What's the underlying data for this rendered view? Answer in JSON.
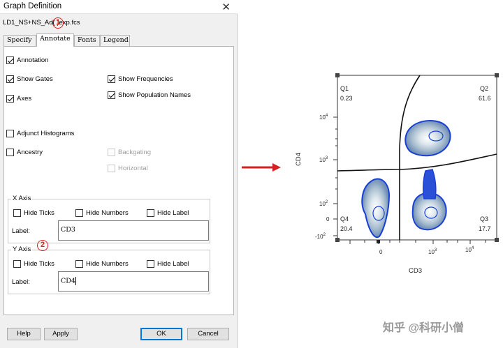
{
  "dialog": {
    "title": "Graph Definition",
    "close_glyph": "✕",
    "filename": "LD1_NS+NS_Ad(  )exp.fcs",
    "callout1": "1",
    "callout2": "2",
    "tabs": [
      {
        "label": "Specify",
        "active": false
      },
      {
        "label": "Annotate",
        "active": true
      },
      {
        "label": "Fonts",
        "active": false
      },
      {
        "label": "Legend",
        "active": false
      }
    ],
    "options": {
      "annotation": {
        "label": "Annotation",
        "checked": true
      },
      "show_gates": {
        "label": "Show Gates",
        "checked": true
      },
      "show_frequencies": {
        "label": "Show Frequencies",
        "checked": true
      },
      "axes": {
        "label": "Axes",
        "checked": true
      },
      "show_population_names": {
        "label": "Show Population Names",
        "checked": true
      },
      "adjunct_histograms": {
        "label": "Adjunct Histograms",
        "checked": false
      },
      "ancestry": {
        "label": "Ancestry",
        "checked": false
      },
      "backgating": {
        "label": "Backgating",
        "checked": false,
        "disabled": true
      },
      "horizontal": {
        "label": "Horizontal",
        "checked": false,
        "disabled": true
      }
    },
    "x_axis": {
      "title": "X Axis",
      "hide_ticks": "Hide Ticks",
      "hide_numbers": "Hide Numbers",
      "hide_label": "Hide Label",
      "label_caption": "Label:",
      "label_value": "CD3"
    },
    "y_axis": {
      "title": "Y Axis",
      "hide_ticks": "Hide Ticks",
      "hide_numbers": "Hide Numbers",
      "hide_label": "Hide Label",
      "label_caption": "Label:",
      "label_value": "CD4"
    },
    "buttons": {
      "help": "Help",
      "apply": "Apply",
      "ok": "OK",
      "cancel": "Cancel"
    }
  },
  "arrow_color": "#d42020",
  "plot": {
    "xlabel": "CD3",
    "ylabel": "CD4",
    "x_ticks": [
      "0",
      "10",
      "10"
    ],
    "x_tick_exps": [
      "",
      "3",
      "4"
    ],
    "y_ticks": [
      "10",
      "10",
      "10",
      "0",
      "-10"
    ],
    "y_tick_exps": [
      "4",
      "3",
      "2",
      "",
      "2"
    ],
    "quadrants": {
      "q1": {
        "name": "Q1",
        "value": "0.23"
      },
      "q2": {
        "name": "Q2",
        "value": "61.6"
      },
      "q3": {
        "name": "Q3",
        "value": "17.7"
      },
      "q4": {
        "name": "Q4",
        "value": "20.4"
      }
    },
    "contour_color": "#1a3fd6"
  },
  "watermark": "知乎 @科研小僧"
}
